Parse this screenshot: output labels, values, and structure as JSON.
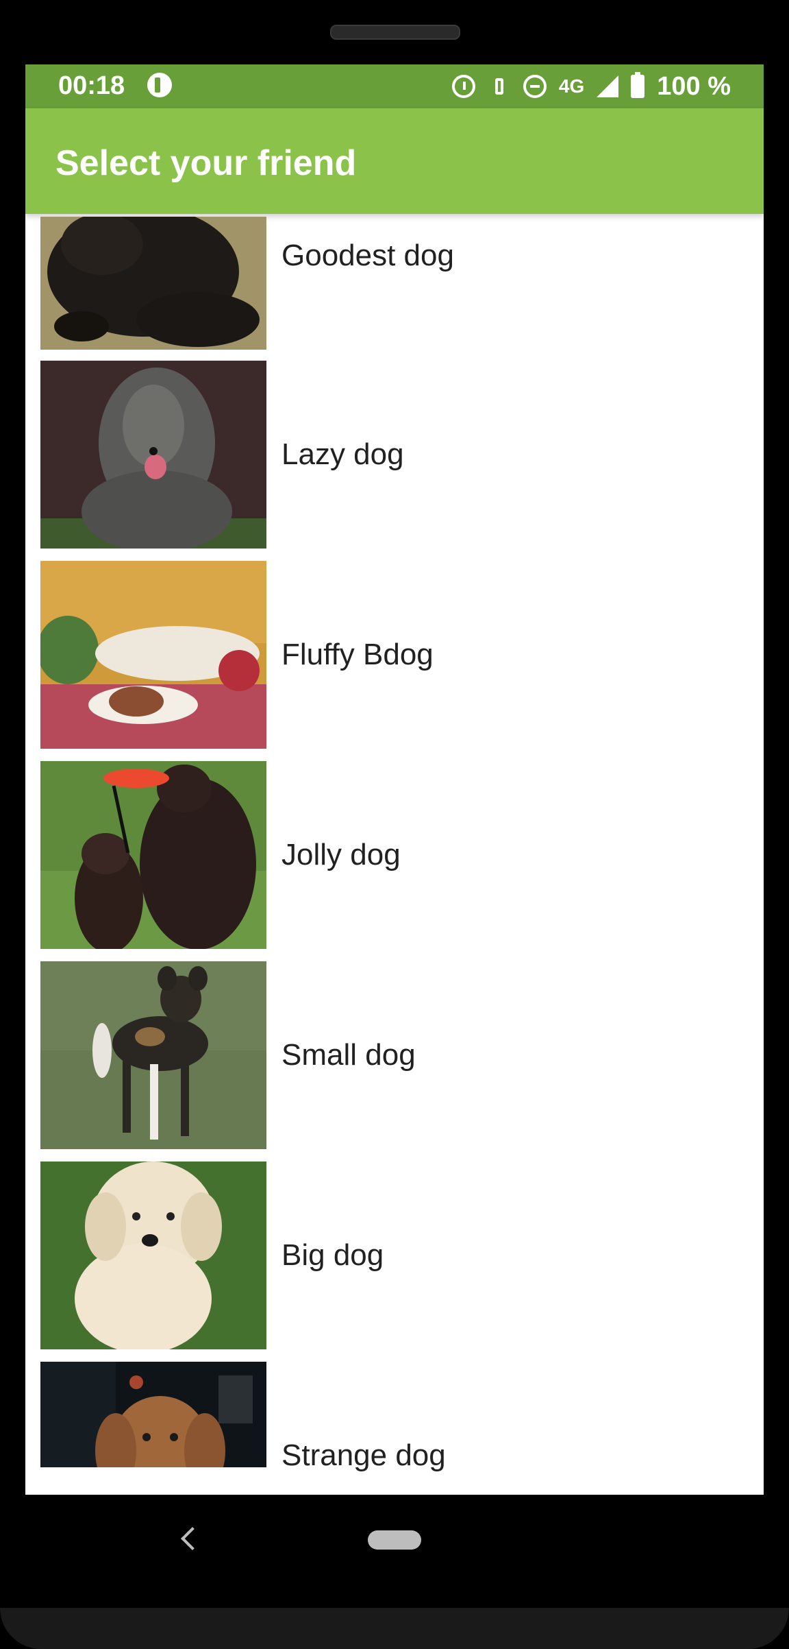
{
  "status_bar": {
    "time": "00:18",
    "network": "4G",
    "battery": "100 %",
    "icons": [
      "alarm-icon",
      "vibrate-icon",
      "do-not-disturb-icon",
      "signal-icon",
      "battery-icon"
    ]
  },
  "app_bar": {
    "title": "Select your friend",
    "color": "#8bc34a",
    "status_color": "#689f38"
  },
  "list": {
    "items": [
      {
        "label": "Goodest dog"
      },
      {
        "label": "Lazy dog"
      },
      {
        "label": "Fluffy Bdog"
      },
      {
        "label": "Jolly dog"
      },
      {
        "label": "Small dog"
      },
      {
        "label": "Big dog"
      },
      {
        "label": "Strange dog"
      }
    ]
  },
  "navigation": {
    "icons": [
      "back-icon",
      "home-pill-icon"
    ]
  }
}
